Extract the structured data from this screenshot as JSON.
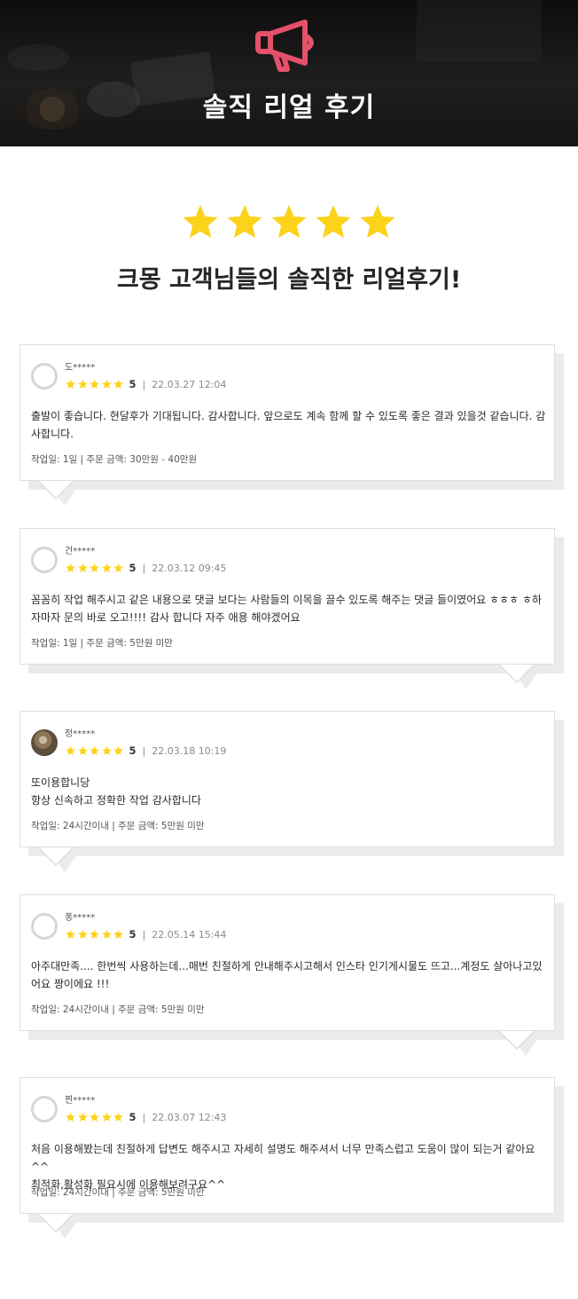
{
  "header": {
    "title": "솔직 리얼 후기",
    "icon": "megaphone-icon",
    "accent_color": "#e5506a"
  },
  "intro": {
    "star_count": 5,
    "star_color": "#fcd21b",
    "subtitle": "크몽 고객님들의 솔직한 리얼후기!"
  },
  "reviews": [
    {
      "name": "도*****",
      "rating": "5",
      "date": "22.03.27 12:04",
      "body": "출발이 좋습니다. 현달후가 기대됩니다. 감사합니다. 앞으로도 계속 함께 할 수 있도록 좋은 결과 있을것 같습니다. 감사합니다.",
      "meta": "작업일: 1일 | 주문 금액: 30만원 - 40만원",
      "avatar": "default",
      "tail": "left"
    },
    {
      "name": "건*****",
      "rating": "5",
      "date": "22.03.12 09:45",
      "body": "꼼꼼히 작업 해주시고 같은 내용으로 댓글 보다는 사람들의 이목을 끌수 있도록 해주는 댓글 들이였어요 ㅎㅎㅎ ㅎ하자마자 문의 바로 오고!!!! 감사 합니다 자주 애용 해야겠어요",
      "meta": "작업일: 1일 | 주문 금액: 5만원 미만",
      "avatar": "default",
      "tail": "right"
    },
    {
      "name": "정*****",
      "rating": "5",
      "date": "22.03.18 10:19",
      "body": "또이용합니당\n항상 신속하고 정확한 작업 감사합니다",
      "meta": "작업일: 24시간이내 | 주문 금액: 5만원 미만",
      "avatar": "photo",
      "tail": "left"
    },
    {
      "name": "퐁*****",
      "rating": "5",
      "date": "22.05.14 15:44",
      "body": "아주대만족.... 한번씩 사용하는데...매번 친절하게 안내해주시고해서  인스타  인기게시물도 뜨고...계정도 살아나고있어요 짱이에요 !!!",
      "meta": "작업일: 24시간이내 | 주문 금액: 5만원 미만",
      "avatar": "default",
      "tail": "right"
    },
    {
      "name": "찐*****",
      "rating": "5",
      "date": "22.03.07 12:43",
      "body": "처음 이용해봤는데 친절하게 답변도 해주시고 자세히 설명도 해주셔서 너무 만족스럽고 도움이 많이 되는거 같아요^^\n최적화,활성화 필요시에 이용해보려구요^^",
      "meta": "작업일: 24시간이내 | 주문 금액: 5만원 미만",
      "avatar": "default",
      "tail": "left"
    }
  ]
}
